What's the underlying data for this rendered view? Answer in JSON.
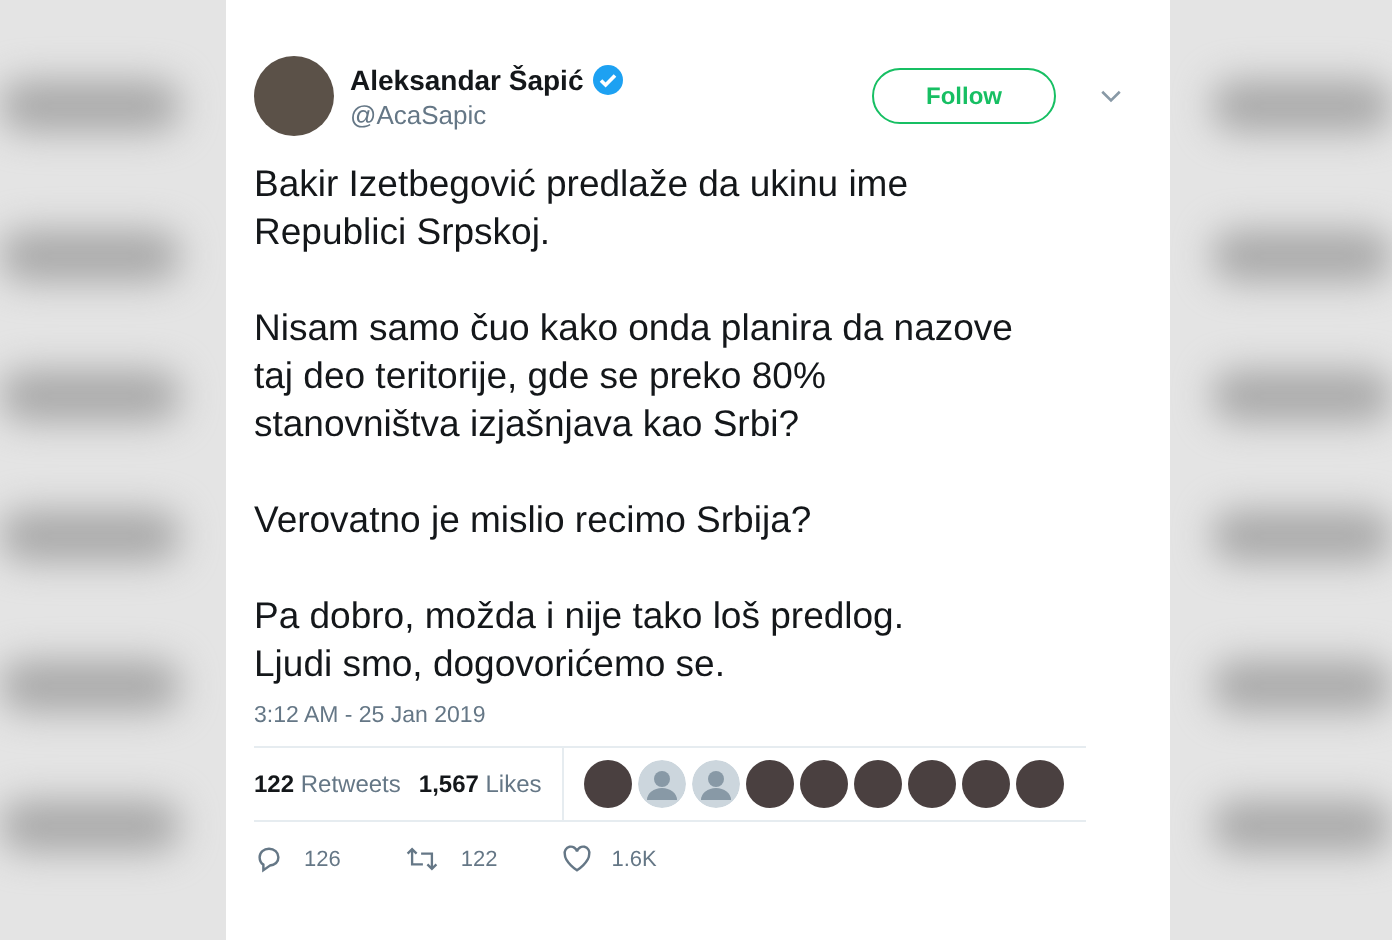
{
  "author": {
    "name": "Aleksandar Šapić",
    "verified": true,
    "handle": "@AcaSapic"
  },
  "follow_button": "Follow",
  "tweet_paragraphs": [
    "Bakir Izetbegović predlaže da ukinu ime\nRepublici Srpskoj.",
    "Nisam samo čuo kako onda planira da nazove\ntaj deo teritorije, gde se preko 80%\nstanovništva izjašnjava kao Srbi?",
    "Verovatno je mislio recimo Srbija?",
    "Pa dobro, možda i nije tako loš predlog.\nLjudi smo, dogovorićemo se."
  ],
  "timestamp": "3:12 AM - 25 Jan 2019",
  "stats": [
    {
      "count": "122",
      "label": "Retweets"
    },
    {
      "count": "1,567",
      "label": "Likes"
    }
  ],
  "likers": [
    {
      "kind": "photo"
    },
    {
      "kind": "default"
    },
    {
      "kind": "default"
    },
    {
      "kind": "photo"
    },
    {
      "kind": "photo"
    },
    {
      "kind": "photo"
    },
    {
      "kind": "photo"
    },
    {
      "kind": "photo"
    },
    {
      "kind": "photo"
    }
  ],
  "actions": [
    {
      "kind": "reply",
      "count": "126"
    },
    {
      "kind": "retweet",
      "count": "122"
    },
    {
      "kind": "like",
      "count": "1.6K"
    }
  ]
}
